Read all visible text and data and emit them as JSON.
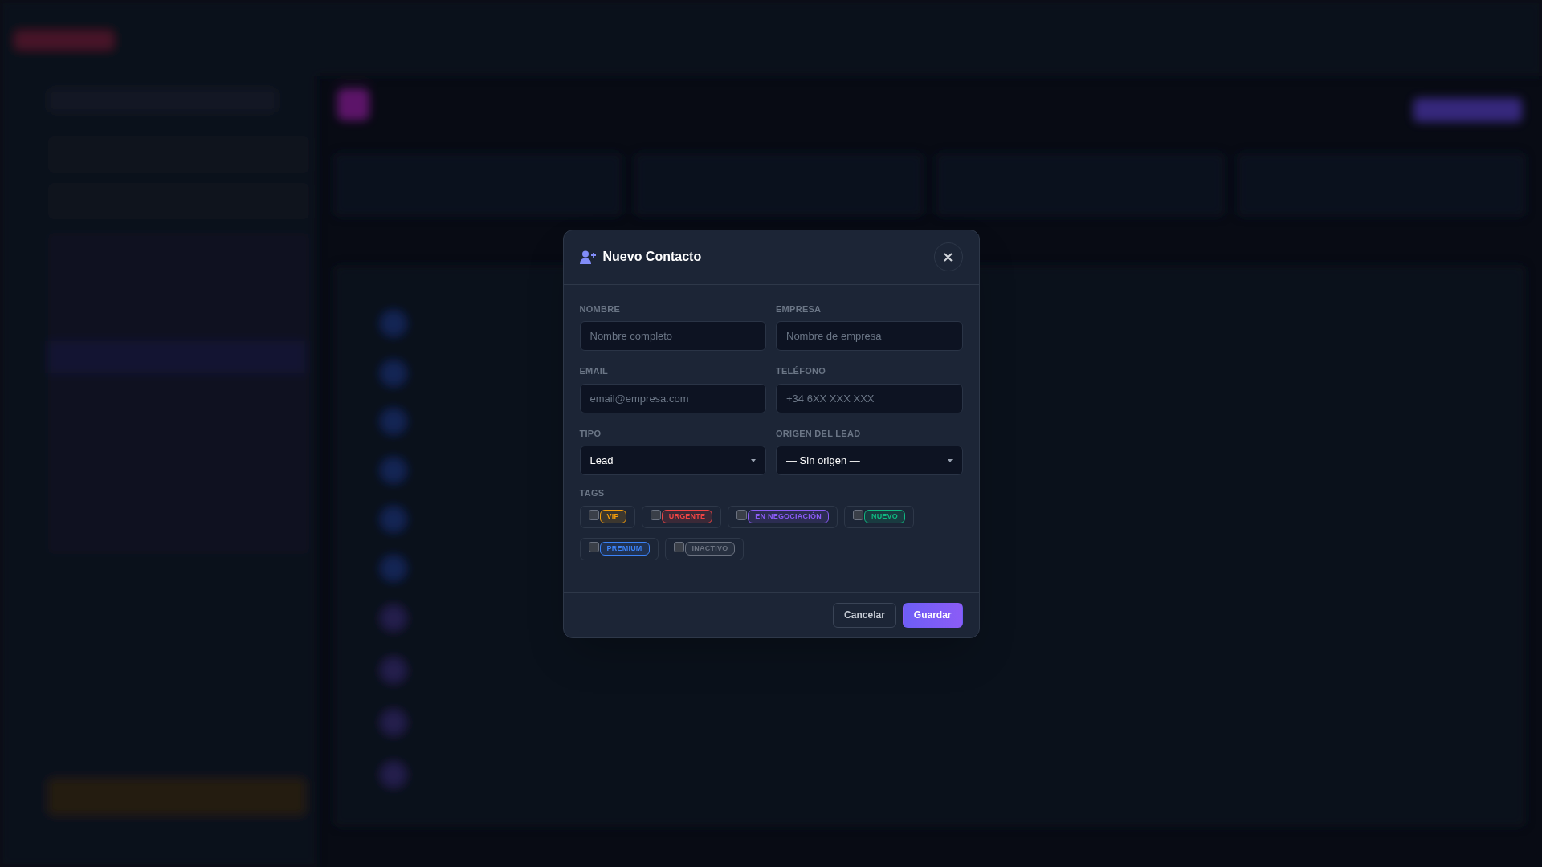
{
  "dialog": {
    "title": "Nuevo Contacto",
    "fields": [
      {
        "kind": "input",
        "label": "NOMBRE",
        "placeholder": "Nombre completo"
      },
      {
        "kind": "input",
        "label": "EMPRESA",
        "placeholder": "Nombre de empresa"
      },
      {
        "kind": "input",
        "label": "EMAIL",
        "placeholder": "email@empresa.com"
      },
      {
        "kind": "input",
        "label": "TELÉFONO",
        "placeholder": "+34 6XX XXX XXX"
      },
      {
        "kind": "select",
        "label": "TIPO",
        "value": "Lead"
      },
      {
        "kind": "select",
        "label": "ORIGEN DEL LEAD",
        "value": "— Sin origen —"
      }
    ],
    "tags_label": "TAGS",
    "tags": [
      {
        "label": "VIP",
        "checked": false,
        "color": "#f59e0b"
      },
      {
        "label": "URGENTE",
        "checked": false,
        "color": "#ef4444"
      },
      {
        "label": "EN NEGOCIACIÓN",
        "checked": false,
        "color": "#8b5cf6"
      },
      {
        "label": "NUEVO",
        "checked": false,
        "color": "#10b981"
      },
      {
        "label": "PREMIUM",
        "checked": false,
        "color": "#3b82f6"
      },
      {
        "label": "INACTIVO",
        "checked": false,
        "color": "#6b7280"
      }
    ],
    "buttons": [
      {
        "kind": "secondary",
        "label": "Cancelar"
      },
      {
        "kind": "primary",
        "label": "Guardar"
      }
    ]
  }
}
